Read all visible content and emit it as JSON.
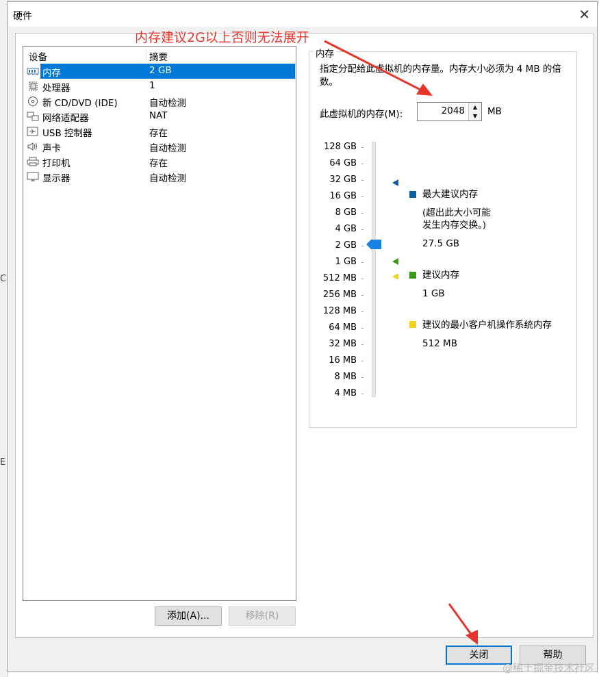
{
  "background": {
    "left_fragments": [
      "Ce",
      "E"
    ]
  },
  "dialog": {
    "title": "硬件",
    "close_glyph": "✕"
  },
  "annotation": {
    "text": "内存建议2G以上否则无法展开",
    "color": "#e8352b"
  },
  "device_list": {
    "columns": [
      "设备",
      "摘要"
    ],
    "rows": [
      {
        "icon": "memory-icon",
        "name": "内存",
        "summary": "2 GB",
        "selected": true
      },
      {
        "icon": "processor-icon",
        "name": "处理器",
        "summary": "1",
        "selected": false
      },
      {
        "icon": "cd-dvd-icon",
        "name": "新 CD/DVD (IDE)",
        "summary": "自动检测",
        "selected": false
      },
      {
        "icon": "network-adapter-icon",
        "name": "网络适配器",
        "summary": "NAT",
        "selected": false
      },
      {
        "icon": "usb-icon",
        "name": "USB 控制器",
        "summary": "存在",
        "selected": false
      },
      {
        "icon": "sound-card-icon",
        "name": "声卡",
        "summary": "自动检测",
        "selected": false
      },
      {
        "icon": "printer-icon",
        "name": "打印机",
        "summary": "存在",
        "selected": false
      },
      {
        "icon": "display-icon",
        "name": "显示器",
        "summary": "自动检测",
        "selected": false
      }
    ],
    "add_button": "添加(A)...",
    "remove_button": "移除(R)"
  },
  "memory_panel": {
    "group_title": "内存",
    "description": "指定分配给此虚拟机的内存量。内存大小必须为 4 MB 的倍数。",
    "memory_label": "此虚拟机的内存(M):",
    "memory_value": "2048",
    "memory_unit": "MB",
    "scale_labels": [
      "128 GB",
      "64 GB",
      "32 GB",
      "16 GB",
      "8 GB",
      "4 GB",
      "2 GB",
      "1 GB",
      "512 MB",
      "256 MB",
      "128 MB",
      "64 MB",
      "32 MB",
      "16 MB",
      "8 MB",
      "4 MB"
    ],
    "current_setting": "2 GB",
    "max_recommended_label": "最大建议内存",
    "max_recommended_note_line1": "(超出此大小可能",
    "max_recommended_note_line2": "发生内存交换。)",
    "max_recommended_value": "27.5 GB",
    "recommended_label": "建议内存",
    "recommended_value": "1 GB",
    "min_guest_label": "建议的最小客户机操作系统内存",
    "min_guest_value": "512 MB",
    "colors": {
      "max": "#0b5fa5",
      "recommended": "#3a9a1a",
      "min_guest": "#f2d21a",
      "thumb": "#1a82e2"
    }
  },
  "footer": {
    "close_button": "关闭",
    "help_button": "帮助"
  },
  "watermark": "@稀土掘金技术社区"
}
